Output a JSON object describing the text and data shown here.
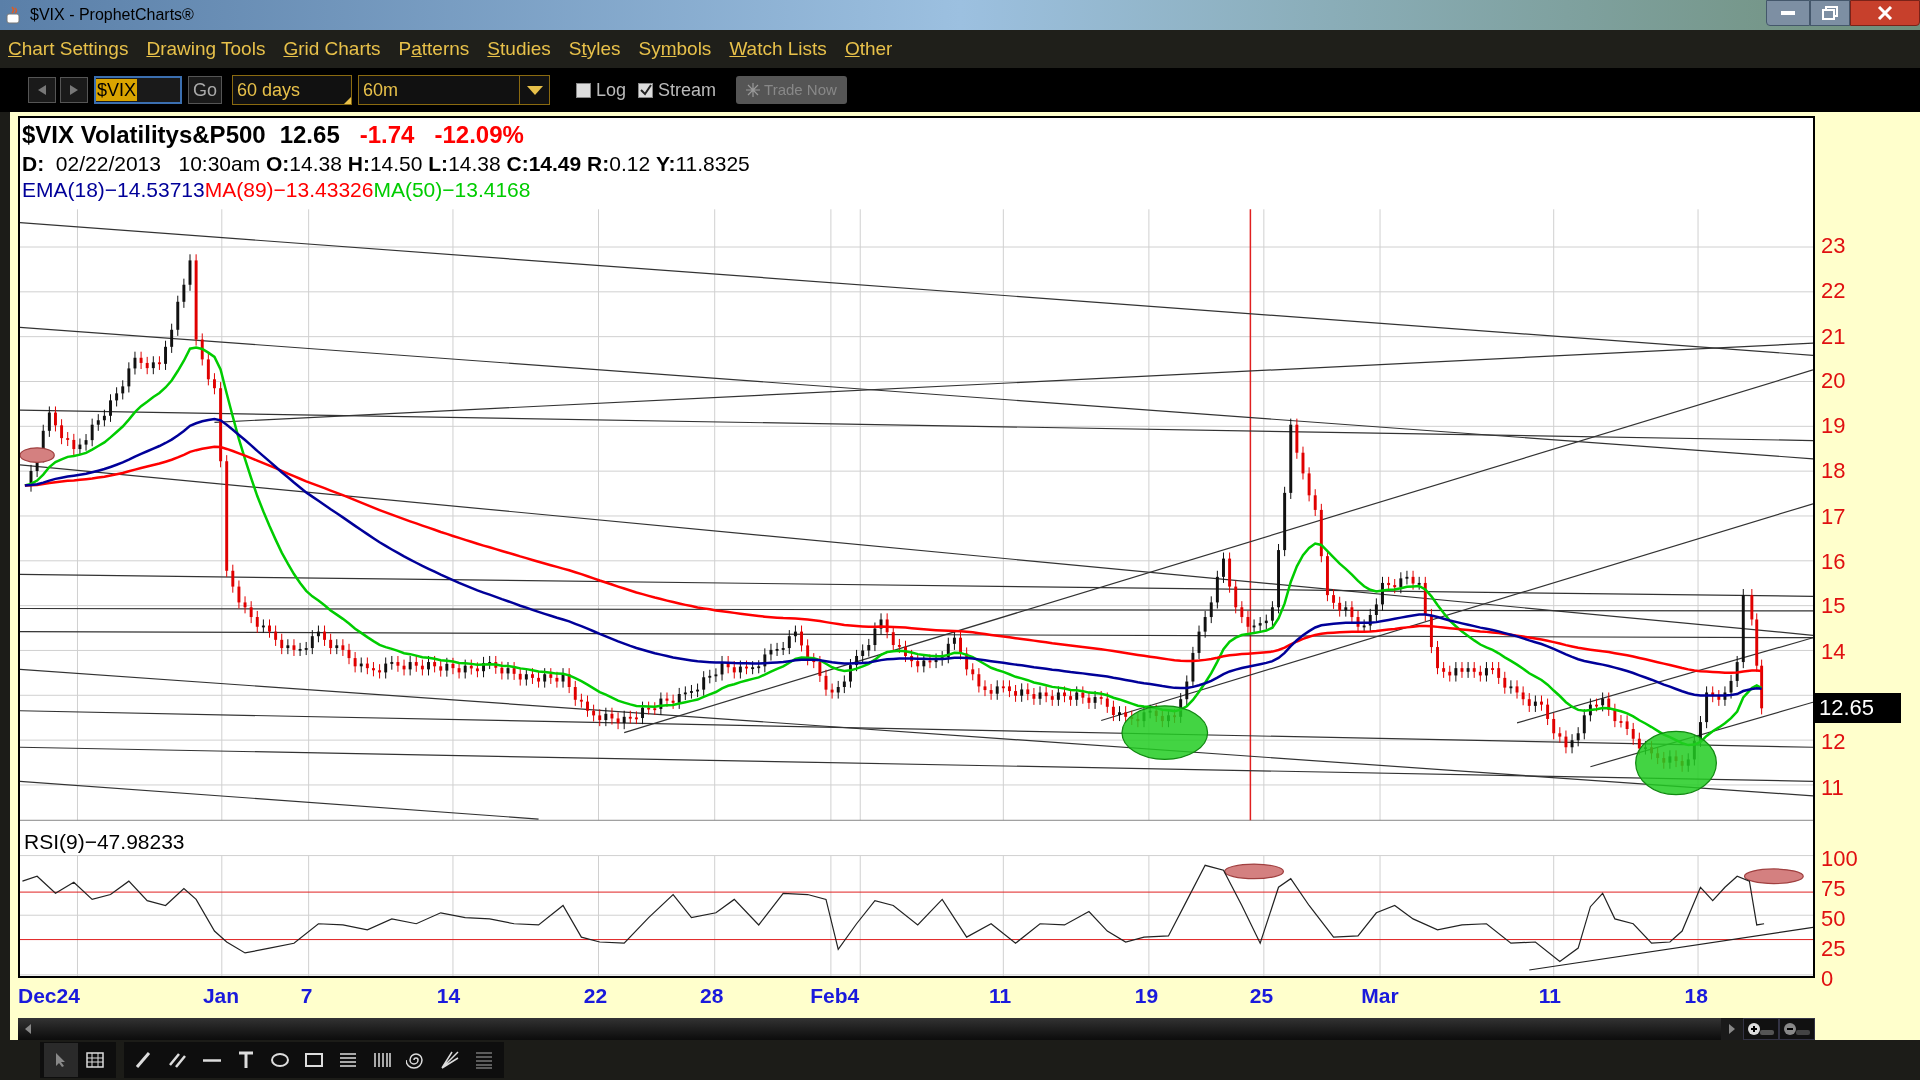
{
  "window": {
    "title": "$VIX - ProphetCharts®"
  },
  "menu": [
    {
      "mnemonic": "C",
      "after": "hart Settings"
    },
    {
      "mnemonic": "D",
      "after": "rawing Tools"
    },
    {
      "mnemonic": "G",
      "after": "rid Charts"
    },
    {
      "before": "P",
      "mnemonic": "a",
      "after": "tterns"
    },
    {
      "mnemonic": "S",
      "after": "tudies"
    },
    {
      "before": "S",
      "mnemonic": "t",
      "after": "yles"
    },
    {
      "before": "Sy",
      "mnemonic": "m",
      "after": "bols"
    },
    {
      "mnemonic": "W",
      "after": "atch Lists"
    },
    {
      "mnemonic": "O",
      "after": "ther"
    }
  ],
  "toolbar": {
    "symbol": "$VIX",
    "go": "Go",
    "range": "60 days",
    "interval": "60m",
    "options": [
      {
        "label": "Log",
        "checked": false
      },
      {
        "label": "Stream",
        "checked": true
      }
    ],
    "trade_button": {
      "label": "Trade Now",
      "disabled": true
    }
  },
  "chart": {
    "header": {
      "symbol": "$VIX Volatilitys&P500",
      "last": "12.65",
      "change": "-1.74",
      "change_pct": "-12.09%"
    },
    "quote": "**D:**  02/22/2013   10:30am **O:**14.38 **H:**14.50 **L:**14.38 **C:14.49** **R:**0.12 **Y:**11.8325",
    "indicators": [
      {
        "label": "EMA(18)−14.53713",
        "color": "#000099"
      },
      {
        "label": "MA(89)−13.43326",
        "color": "#ff0000"
      },
      {
        "label": "MA(50)−13.4168",
        "color": "#00cc00"
      }
    ],
    "price_axis": [
      "23",
      "22",
      "21",
      "20",
      "19",
      "18",
      "17",
      "16",
      "15",
      "14",
      "12",
      "11"
    ],
    "price_tag": "12.65",
    "rsi": {
      "label": "RSI(9)−47.98233",
      "axis": [
        "100",
        "75",
        "50",
        "25",
        "0"
      ]
    },
    "x_axis": [
      "Dec24",
      "Jan",
      "7",
      "14",
      "22",
      "28",
      "Feb4",
      "11",
      "19",
      "25",
      "Mar",
      "11",
      "18"
    ]
  }
}
